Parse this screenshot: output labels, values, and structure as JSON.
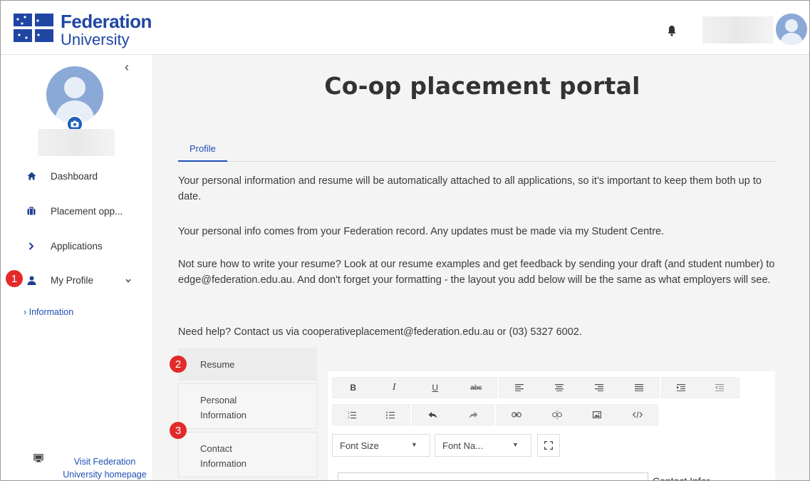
{
  "header": {
    "logo": {
      "line1": "Federation",
      "line2": "University"
    }
  },
  "sidebar": {
    "collapse_glyph": "‹",
    "nav": [
      {
        "label": "Dashboard",
        "icon": "home-icon"
      },
      {
        "label": "Placement opp...",
        "icon": "briefcase-icon"
      },
      {
        "label": "Applications",
        "icon": "chevron-right-icon"
      },
      {
        "label": "My Profile",
        "icon": "person-icon"
      }
    ],
    "sub_item": "› Information",
    "footer_link": "Visit Federation University homepage"
  },
  "badges": {
    "one": "1",
    "two": "2",
    "three": "3"
  },
  "main": {
    "title": "Co-op placement portal",
    "tab": "Profile",
    "paragraphs": [
      "Your personal information and resume will be automatically attached to all applications, so it’s important to keep them both up to date.",
      "Your personal info comes from your Federation record. Any updates must be made via my Student Centre.",
      "Not sure how to write your resume? Look at our resume examples and get feedback by sending your draft (and student number) to edge@federation.edu.au. And don't forget your formatting - the layout you add below will be the same as what employers will see.",
      "Need help? Contact us via cooperativeplacement@federation.edu.au or (03) 5327 6002."
    ],
    "vertical_tabs": [
      {
        "label": "Resume"
      },
      {
        "label_line1": "Personal",
        "label_line2": "Information"
      },
      {
        "label_line1": "Contact",
        "label_line2": "Information"
      }
    ]
  },
  "editor": {
    "toolbar_row1": {
      "bold": "B",
      "italic": "I",
      "underline": "U",
      "strikethrough": "abc"
    },
    "font_size_label": "Font Size",
    "font_name_label": "Font Na...",
    "side_text": "Contact Infor"
  },
  "colors": {
    "brand_blue": "#2046a3",
    "link_blue": "#1f4fb5",
    "badge_red": "#e32a2a",
    "main_bg": "#f4f4f4"
  }
}
